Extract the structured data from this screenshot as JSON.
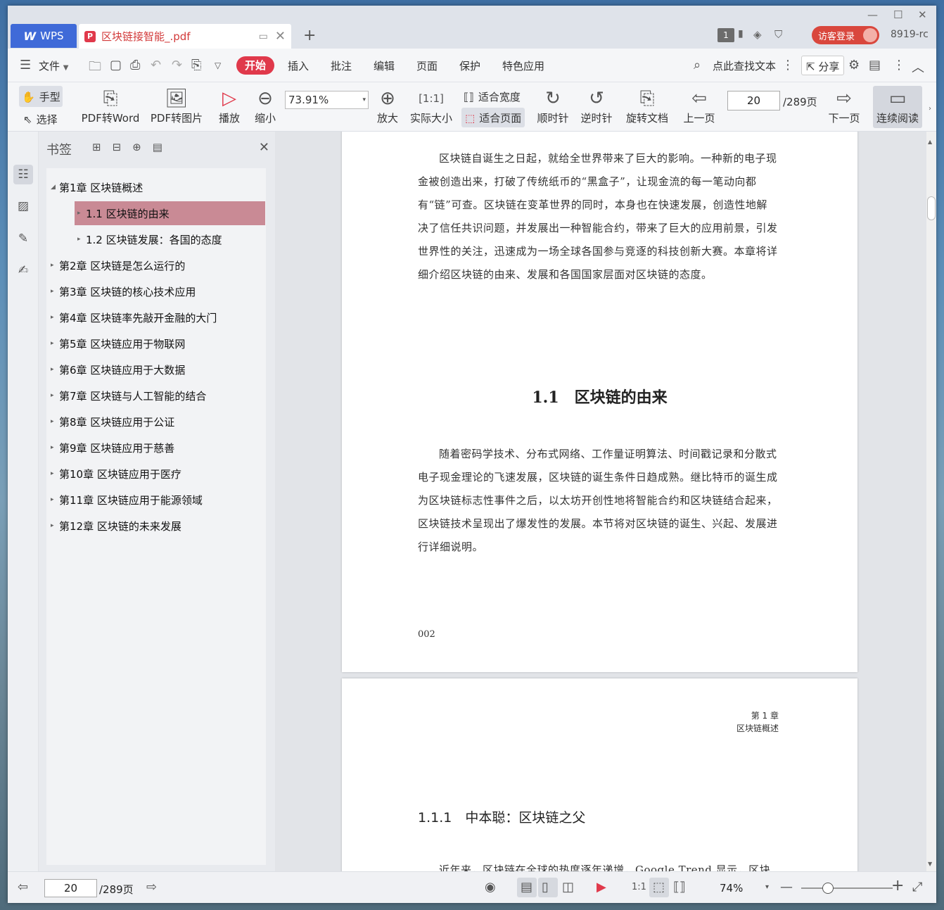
{
  "titlebar": {
    "app_tab": "WPS",
    "doc_tab": "区块链接智能_.pdf",
    "badge": "1",
    "login": "访客登录",
    "user": "8919-rc"
  },
  "menu": {
    "file": "文件",
    "tabs": [
      "开始",
      "插入",
      "批注",
      "编辑",
      "页面",
      "保护",
      "特色应用"
    ],
    "search": "点此查找文本",
    "share": "分享"
  },
  "ribbon": {
    "hand": "手型",
    "select": "选择",
    "pdf_to_word": "PDF转Word",
    "pdf_to_image": "PDF转图片",
    "play": "播放",
    "zoom_out": "缩小",
    "zoom_value": "73.91%",
    "zoom_in": "放大",
    "actual_size": "实际大小",
    "fit_width": "适合宽度",
    "fit_page": "适合页面",
    "rotate_cw": "顺时针",
    "rotate_ccw": "逆时针",
    "rotate_doc": "旋转文档",
    "prev_page": "上一页",
    "page_current": "20",
    "page_total": "/289页",
    "next_page": "下一页",
    "continuous": "连续阅读"
  },
  "bookmarks": {
    "title": "书签",
    "items": [
      {
        "label": "第1章 区块链概述",
        "level": 0,
        "expanded": true
      },
      {
        "label": "1.1 区块链的由来",
        "level": 1,
        "selected": true
      },
      {
        "label": "1.2 区块链发展：各国的态度",
        "level": 1
      },
      {
        "label": "第2章 区块链是怎么运行的",
        "level": 0
      },
      {
        "label": "第3章 区块链的核心技术应用",
        "level": 0
      },
      {
        "label": "第4章 区块链率先敲开金融的大门",
        "level": 0
      },
      {
        "label": "第5章 区块链应用于物联网",
        "level": 0
      },
      {
        "label": "第6章 区块链应用于大数据",
        "level": 0
      },
      {
        "label": "第7章 区块链与人工智能的结合",
        "level": 0
      },
      {
        "label": "第8章 区块链应用于公证",
        "level": 0
      },
      {
        "label": "第9章 区块链应用于慈善",
        "level": 0
      },
      {
        "label": "第10章 区块链应用于医疗",
        "level": 0
      },
      {
        "label": "第11章 区块链应用于能源领域",
        "level": 0
      },
      {
        "label": "第12章 区块链的未来发展",
        "level": 0
      }
    ]
  },
  "page1": {
    "para1": "区块链自诞生之日起，就给全世界带来了巨大的影响。一种新的电子现金被创造出来，打破了传统纸币的“黑盒子”，让现金流的每一笔动向都有“链”可查。区块链在变革世界的同时，本身也在快速发展，创造性地解决了信任共识问题，并发展出一种智能合约，带来了巨大的应用前景，引发世界性的关注，迅速成为一场全球各国参与竞逐的科技创新大赛。本章将详细介绍区块链的由来、发展和各国国家层面对区块链的态度。",
    "section_title": "1.1　区块链的由来",
    "para2": "随着密码学技术、分布式网络、工作量证明算法、时间戳记录和分散式电子现金理论的飞速发展，区块链的诞生条件日趋成熟。继比特币的诞生成为区块链标志性事件之后，以太坊开创性地将智能合约和区块链结合起来，区块链技术呈现出了爆发性的发展。本节将对区块链的诞生、兴起、发展进行详细说明。",
    "page_number": "002"
  },
  "page2": {
    "header_chapter": "第 1 章",
    "header_title": "区块链概述",
    "subsection": "1.1.1　中本聪：区块链之父",
    "para_start": "近年来，区块链在全球的热度逐年递增，Google Trend 显示，区块"
  },
  "statusbar": {
    "page_current": "20",
    "page_total": "/289页",
    "zoom": "74%"
  }
}
